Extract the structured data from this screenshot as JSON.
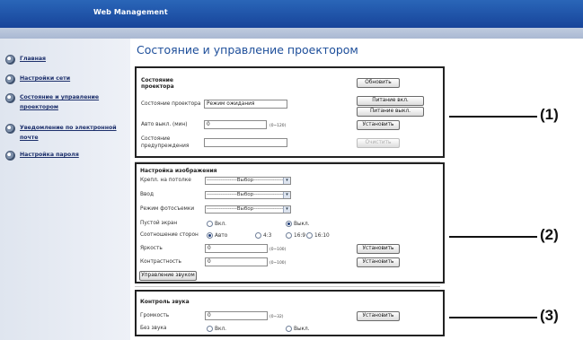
{
  "header": {
    "title": "Web Management"
  },
  "sidebar": {
    "items": [
      {
        "label": "Главная"
      },
      {
        "label": "Настройки сети"
      },
      {
        "label": "Состояние и управление проектором"
      },
      {
        "label": "Уведомление по электронной почте"
      },
      {
        "label": "Настройка пароля"
      }
    ]
  },
  "main": {
    "title": "Состояние и управление проектором"
  },
  "status_section": {
    "heading": "Состояние проектора",
    "refresh_button": "Обновить",
    "power_on_button": "Питание вкл.",
    "power_off_button": "Питание выкл.",
    "state_label": "Состояние проектора",
    "state_value": "Режим ожидания",
    "auto_off_label": "Авто выкл. (мин)",
    "auto_off_value": "0",
    "auto_off_hint": "(0~120)",
    "set_button": "Установить",
    "warning_label": "Состояние предупреждения",
    "warning_value": "",
    "clear_button": "Очистить"
  },
  "image_section": {
    "heading": "Настройка изображения",
    "ceiling_label": "Крепл. на потолке",
    "input_label": "Ввод",
    "photo_label": "Режим фотосъемки",
    "select_placeholder": "-----------------Выбор-----------------",
    "blank_label": "Пустой экран",
    "blank_on": "Вкл.",
    "blank_off": "Выкл.",
    "aspect_label": "Соотношение сторон",
    "aspect_options": [
      "Авто",
      "4:3",
      "16:9",
      "16:10"
    ],
    "brightness_label": "Яркость",
    "brightness_value": "0",
    "brightness_hint": "(0~100)",
    "contrast_label": "Контрастность",
    "contrast_value": "0",
    "contrast_hint": "(0~100)",
    "set_button": "Установить",
    "sound_button": "Управление звуком"
  },
  "sound_section": {
    "heading": "Контроль звука",
    "volume_label": "Громкость",
    "volume_value": "0",
    "volume_hint": "(0~32)",
    "set_button": "Установить",
    "mute_label": "Без звука",
    "mute_on": "Вкл.",
    "mute_off": "Выкл."
  },
  "callouts": {
    "one": "(1)",
    "two": "(2)",
    "three": "(3)"
  }
}
